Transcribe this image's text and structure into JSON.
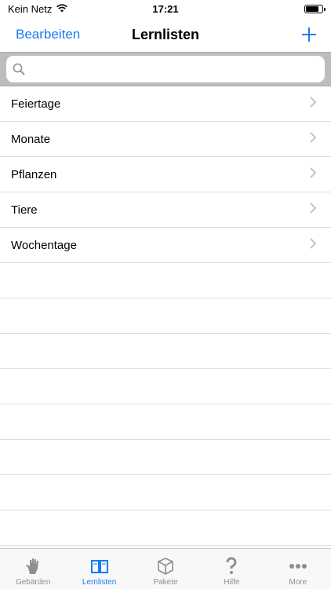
{
  "status_bar": {
    "carrier": "Kein Netz",
    "time": "17:21",
    "battery_level": 0.8
  },
  "nav": {
    "edit_label": "Bearbeiten",
    "title": "Lernlisten",
    "add_icon": "plus-icon"
  },
  "search": {
    "placeholder": "",
    "value": ""
  },
  "list": {
    "items": [
      {
        "label": "Feiertage"
      },
      {
        "label": "Monate"
      },
      {
        "label": "Pflanzen"
      },
      {
        "label": "Tiere"
      },
      {
        "label": "Wochentage"
      }
    ],
    "empty_rows": 8
  },
  "tabs": [
    {
      "label": "Gebärden",
      "icon": "hand-icon",
      "active": false
    },
    {
      "label": "Lernlisten",
      "icon": "book-icon",
      "active": true
    },
    {
      "label": "Pakete",
      "icon": "box-icon",
      "active": false
    },
    {
      "label": "Hilfe",
      "icon": "question-icon",
      "active": false
    },
    {
      "label": "More",
      "icon": "more-icon",
      "active": false
    }
  ],
  "colors": {
    "accent": "#1a7cf0",
    "inactive": "#8e8e93"
  }
}
